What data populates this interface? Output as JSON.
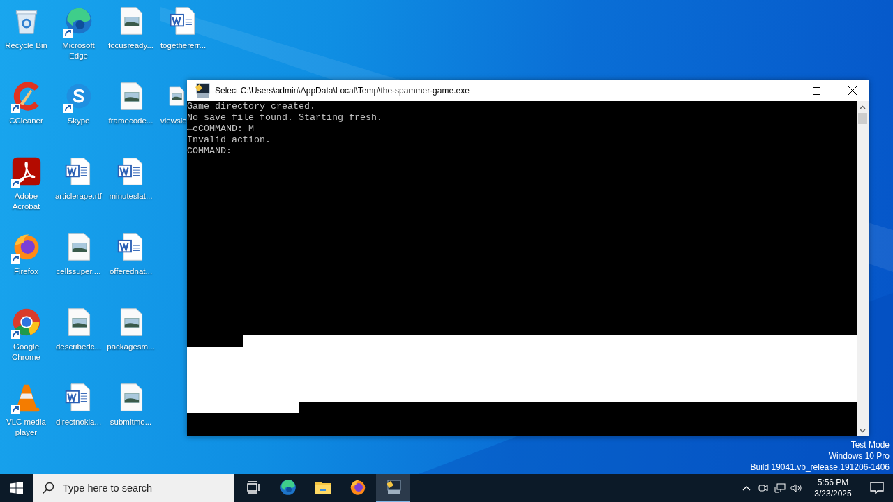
{
  "desktop_icons": [
    {
      "label": "Recycle Bin",
      "kind": "recycle",
      "shortcut": false
    },
    {
      "label": "CCleaner",
      "kind": "ccleaner",
      "shortcut": true
    },
    {
      "label": "Adobe Acrobat",
      "kind": "acrobat",
      "shortcut": true
    },
    {
      "label": "Firefox",
      "kind": "firefox",
      "shortcut": true
    },
    {
      "label": "Google Chrome",
      "kind": "chrome",
      "shortcut": true
    },
    {
      "label": "VLC media player",
      "kind": "vlc",
      "shortcut": true
    },
    {
      "label": "Microsoft Edge",
      "kind": "edge",
      "shortcut": true
    },
    {
      "label": "Skype",
      "kind": "skype",
      "shortcut": true
    },
    {
      "label": "articlerape.rtf",
      "kind": "word",
      "shortcut": false
    },
    {
      "label": "cellssuper....",
      "kind": "image",
      "shortcut": false
    },
    {
      "label": "describedc...",
      "kind": "image",
      "shortcut": false
    },
    {
      "label": "directnokia...",
      "kind": "word",
      "shortcut": false
    },
    {
      "label": "focusready...",
      "kind": "image",
      "shortcut": false
    },
    {
      "label": "framecode...",
      "kind": "image",
      "shortcut": false
    },
    {
      "label": "minuteslat...",
      "kind": "word",
      "shortcut": false
    },
    {
      "label": "offerednat...",
      "kind": "word",
      "shortcut": false
    },
    {
      "label": "packagesm...",
      "kind": "image",
      "shortcut": false
    },
    {
      "label": "submitmo...",
      "kind": "image",
      "shortcut": false
    },
    {
      "label": "togethererr...",
      "kind": "word",
      "shortcut": false
    },
    {
      "label": "viewsle",
      "kind": "image",
      "shortcut": false
    }
  ],
  "console_window": {
    "title": "Select C:\\Users\\admin\\AppData\\Local\\Temp\\the-spammer-game.exe",
    "lines": [
      "Game directory created.",
      "No save file found. Starting fresh.",
      "←cCOMMAND: M",
      "Invalid action.",
      "COMMAND:"
    ]
  },
  "system_info": [
    "Test Mode",
    "Windows 10 Pro",
    "Build 19041.vb_release.191206-1406"
  ],
  "taskbar": {
    "search": {
      "placeholder": "Type here to search"
    },
    "apps": [
      {
        "kind": "taskview",
        "active": false
      },
      {
        "kind": "edge",
        "active": false
      },
      {
        "kind": "explorer",
        "active": false
      },
      {
        "kind": "firefox",
        "active": false
      },
      {
        "kind": "console",
        "active": true
      }
    ],
    "clock": {
      "time": "5:56 PM",
      "date": "3/23/2025"
    }
  }
}
